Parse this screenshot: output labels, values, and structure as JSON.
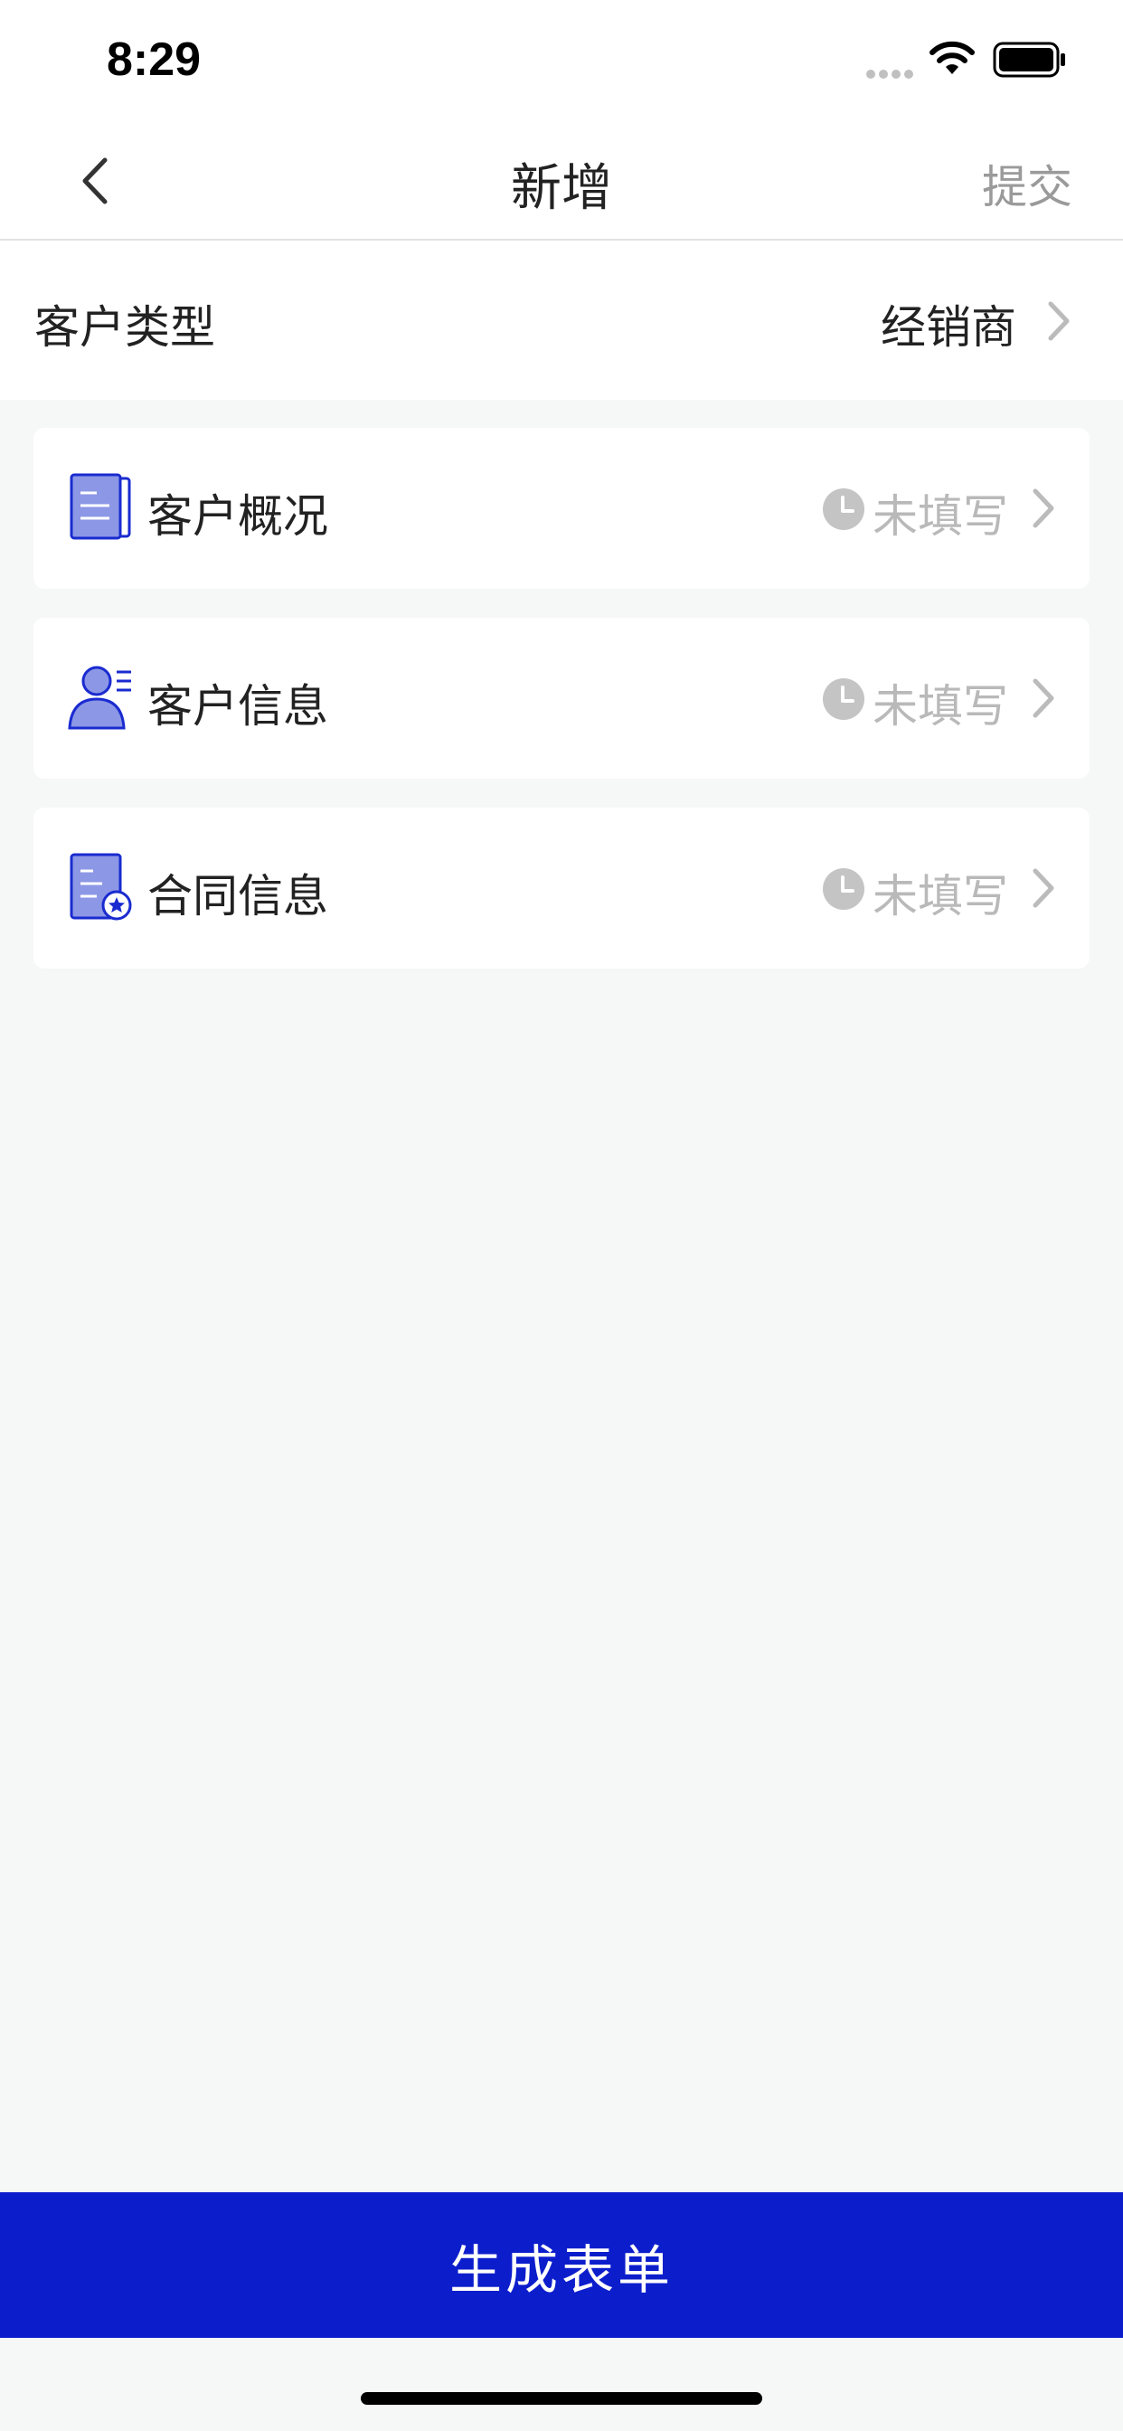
{
  "status_bar": {
    "time": "8:29"
  },
  "nav": {
    "title": "新增",
    "submit_label": "提交"
  },
  "customer_type": {
    "label": "客户类型",
    "value": "经销商"
  },
  "sections": [
    {
      "title": "客户概况",
      "status": "未填写",
      "icon": "document-icon"
    },
    {
      "title": "客户信息",
      "status": "未填写",
      "icon": "person-icon"
    },
    {
      "title": "合同信息",
      "status": "未填写",
      "icon": "contract-icon"
    }
  ],
  "footer": {
    "generate_label": "生成表单"
  },
  "colors": {
    "primary": "#0c1ecc",
    "icon_fill": "#8c97e6",
    "muted": "#b9b9b9"
  }
}
